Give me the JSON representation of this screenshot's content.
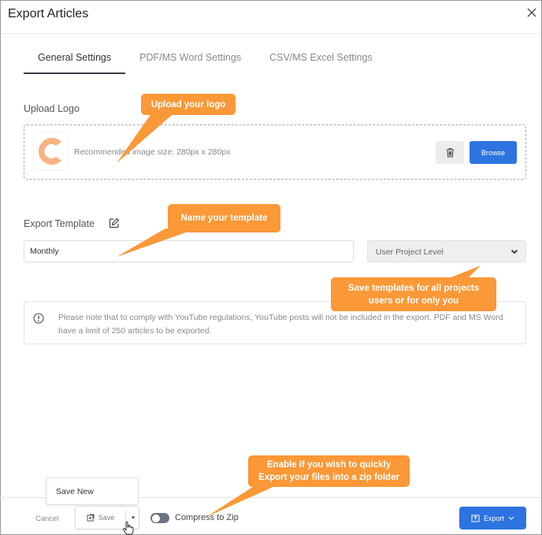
{
  "dialog": {
    "title": "Export Articles",
    "close_icon": "close-icon"
  },
  "tabs": [
    {
      "label": "General Settings",
      "active": true
    },
    {
      "label": "PDF/MS Word Settings",
      "active": false
    },
    {
      "label": "CSV/MS Excel Settings",
      "active": false
    }
  ],
  "upload": {
    "label": "Upload Logo",
    "recommendation": "Recommended image size: 280px x 280px",
    "logo_icon": "c-logo-icon",
    "delete_icon": "trash-icon",
    "browse_label": "Browse"
  },
  "template": {
    "label": "Export Template",
    "edit_icon": "edit-icon",
    "name_value": "Monthly",
    "level_selected": "User Project Level"
  },
  "notice": {
    "icon": "info-icon",
    "text": "Please note that to comply with YouTube regulations, YouTube posts will not be included in the export. PDF and MS Word have a limit of 250 articles to be exported."
  },
  "footer": {
    "cancel_label": "Cancel",
    "save_label": "Save",
    "save_new_label": "Save New",
    "compress_label": "Compress to Zip",
    "compress_enabled": false,
    "export_label": "Export"
  },
  "callouts": {
    "upload": "Upload your logo",
    "template": "Name your template",
    "level_line1": "Save templates for all projects",
    "level_line2": "users or for only you",
    "zip_line1": "Enable if you wish to quickly",
    "zip_line2": "Export your files into a zip folder"
  },
  "colors": {
    "primary": "#2d74e0",
    "callout": "#fb9837",
    "logo": "#f5a06b"
  }
}
